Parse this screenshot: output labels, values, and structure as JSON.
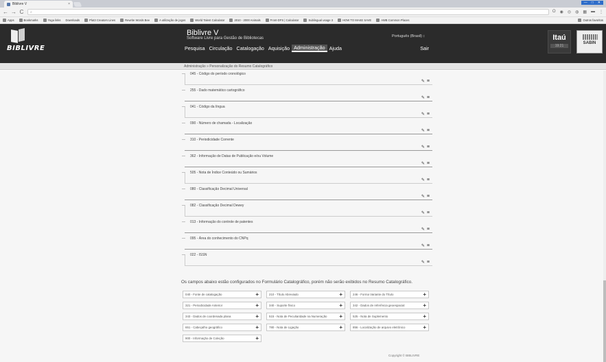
{
  "browser": {
    "tab_title": "Biblivre V",
    "tab_close": "×",
    "window_controls": [
      "—",
      "□",
      "✕"
    ],
    "back": "←",
    "forward": "→",
    "reload": "C",
    "url_text": "",
    "bookmarks": [
      "Apps",
      "Bookmarks",
      "Yoga links",
      "Downloads",
      "Plat3 Creators Lines",
      "Rewrite Words Bee",
      "A utilização de jogos",
      "World Talent Calculator",
      "2010 - 2000 Animals",
      "Front-DFS | Calculator",
      "Sublingual usage 3",
      "HOW TO MAKE SAVE",
      "AWB Common Places"
    ],
    "bookmarks_right": "Outros favoritos"
  },
  "app": {
    "logo_text": "BIBLIVRE",
    "title": "Biblivre V",
    "subtitle": "Software Livre para Gestão de Bibliotecas",
    "language": "Português (Brasil) ↕",
    "menu": [
      "Pesquisa",
      "Circulação",
      "Catalogação",
      "Aquisição",
      "Administração",
      "Ajuda"
    ],
    "menu_exit": "Sair",
    "sponsor_itau": "Itaú",
    "sponsor_itau_time": "19:21",
    "sponsor_sabin": "SABIN"
  },
  "breadcrumb": "Administração » Personalização do Resumo Catalográfico",
  "fields": [
    {
      "label": "045 - Código do período cronológico",
      "style": "boxed"
    },
    {
      "label": "255 - Dado matemático cartográfico",
      "style": "line"
    },
    {
      "label": "041 - Código da língua",
      "style": "boxed"
    },
    {
      "label": "090 - Número de chamada - Localização",
      "style": "line"
    },
    {
      "label": "310 - Periodicidade Corrente",
      "style": "line"
    },
    {
      "label": "362 - Informação de Datas de Publicação e/ou Volume",
      "style": "line"
    },
    {
      "label": "505 - Nota de Índice Conteúdo ou Sumários",
      "style": "boxed"
    },
    {
      "label": "080 - Classificação Decimal Universal",
      "style": "line"
    },
    {
      "label": "082 - Classificação Decimal Dewey",
      "style": "boxed"
    },
    {
      "label": "013 - Informação do controle de patentes",
      "style": "line"
    },
    {
      "label": "095 - Área do conhecimento do CNPq",
      "style": "line"
    },
    {
      "label": "022 - ISSN",
      "style": "boxed"
    }
  ],
  "icons": {
    "edit": "pencil-icon",
    "drag": "drag-handle-icon"
  },
  "note": "Os campos abaixo estão configurados no Formulário Catalográfico, porém não serão exibidos no Resumo Catalográfico.",
  "unused_fields": [
    "040 - Fonte de catalogação",
    "210 - Título Abreviado",
    "246 - Forma Variante do Título",
    "321 - Periodicidade Anterior",
    "340 - Suporte físico",
    "342 - Dados de referência geoespacial",
    "343 - Dados de coordenada plana",
    "515 - Nota de Peculiaridade na Numeração",
    "525 - Nota de Suplemento",
    "651 - Cabeçalho geográfico",
    "780 - Nota de Ligação",
    "856 - Localização de arquivo eletrônico",
    "900 - Informação de Coleção"
  ],
  "footer": "Copyright © BIBLIVRE"
}
